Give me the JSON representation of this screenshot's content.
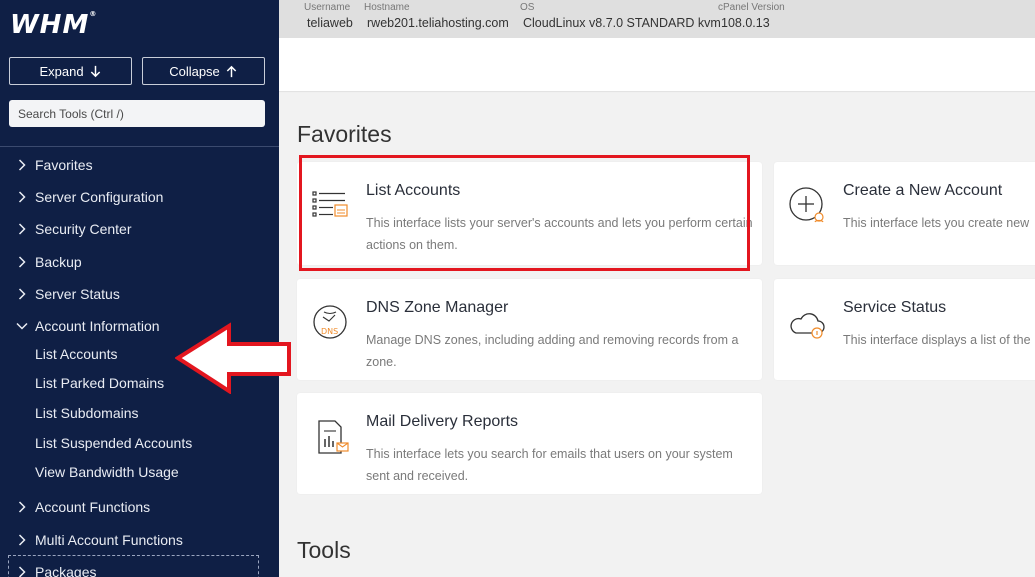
{
  "sidebar": {
    "logo": "WHM",
    "expand_label": "Expand",
    "collapse_label": "Collapse",
    "search_placeholder": "Search Tools (Ctrl /)",
    "categories": [
      {
        "label": "Favorites"
      },
      {
        "label": "Server Configuration"
      },
      {
        "label": "Security Center"
      },
      {
        "label": "Backup"
      },
      {
        "label": "Server Status"
      },
      {
        "label": "Account Information"
      },
      {
        "label": "Account Functions"
      },
      {
        "label": "Multi Account Functions"
      },
      {
        "label": "Packages"
      }
    ],
    "account_info_items": [
      {
        "label": "List Accounts"
      },
      {
        "label": "List Parked Domains"
      },
      {
        "label": "List Subdomains"
      },
      {
        "label": "List Suspended Accounts"
      },
      {
        "label": "View Bandwidth Usage"
      }
    ]
  },
  "topbar": {
    "username_label": "Username",
    "username": "teliaweb",
    "hostname_label": "Hostname",
    "hostname": "rweb201.teliahosting.com",
    "os_label": "OS",
    "os": "CloudLinux v8.7.0 STANDARD kvm",
    "cpanel_label": "cPanel Version",
    "cpanel_version": "108.0.13"
  },
  "main": {
    "favorites_title": "Favorites",
    "tools_title": "Tools",
    "cards": [
      {
        "title": "List Accounts",
        "desc": "This interface lists your server's accounts and lets you perform certain actions on them.",
        "icon": "list-accounts-icon"
      },
      {
        "title": "Create a New Account",
        "desc": "This interface lets you create new",
        "icon": "create-account-icon"
      },
      {
        "title": "DNS Zone Manager",
        "desc": "Manage DNS zones, including adding and removing records from a zone.",
        "icon": "dns-icon",
        "icon_text": "DNS"
      },
      {
        "title": "Service Status",
        "desc": "This interface displays a list of the",
        "icon": "service-status-icon"
      },
      {
        "title": "Mail Delivery Reports",
        "desc": "This interface lets you search for emails that users on your system sent and received.",
        "icon": "mail-report-icon"
      }
    ]
  },
  "colors": {
    "sidebar_bg": "#0f1f45",
    "accent_orange": "#f08c2c",
    "annotation_red": "#e3161f"
  }
}
